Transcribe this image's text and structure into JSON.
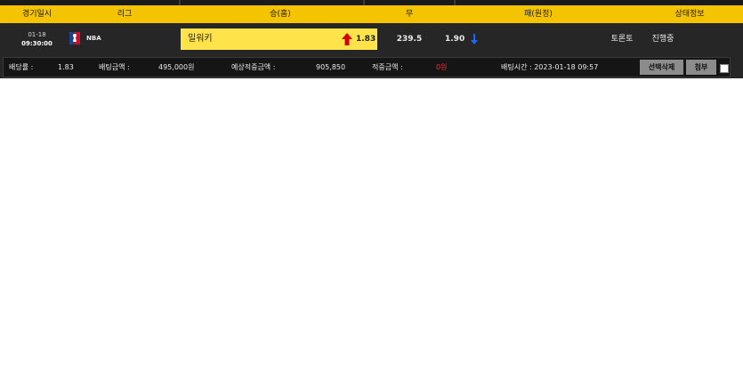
{
  "header": {
    "datetime": "경기일시",
    "league": "리그",
    "home": "승(홈)",
    "draw": "무",
    "away": "패(원정)",
    "status": "상태정보"
  },
  "match": {
    "date": "01-18",
    "time": "09:30:00",
    "league_icon": "nba-logo-icon",
    "league": "NBA",
    "home_team": "밀워키",
    "home_odds": "1.83",
    "home_trend_icon": "up-arrow-icon",
    "draw_value": "239.5",
    "away_odds": "1.90",
    "away_trend_icon": "down-arrow-icon",
    "away_team": "토론토",
    "status": "진행중"
  },
  "bet": {
    "odds_label": "배당률 :",
    "odds_value": "1.83",
    "amount_label": "배팅금액 :",
    "amount_value": "495,000원",
    "expected_label": "예상적중금액 :",
    "expected_value": "905,850",
    "won_label": "적중금액 :",
    "won_value": "0원",
    "time_label": "배팅시간 : 2023-01-18 09:57",
    "delete_button": "선택삭제",
    "attach_button": "첨부"
  },
  "colors": {
    "header_bg": "#f5c400",
    "selected_bg": "#ffe34a",
    "up_arrow": "#d40000",
    "down_arrow": "#1e66ff",
    "won_value": "#ff2a2a"
  }
}
